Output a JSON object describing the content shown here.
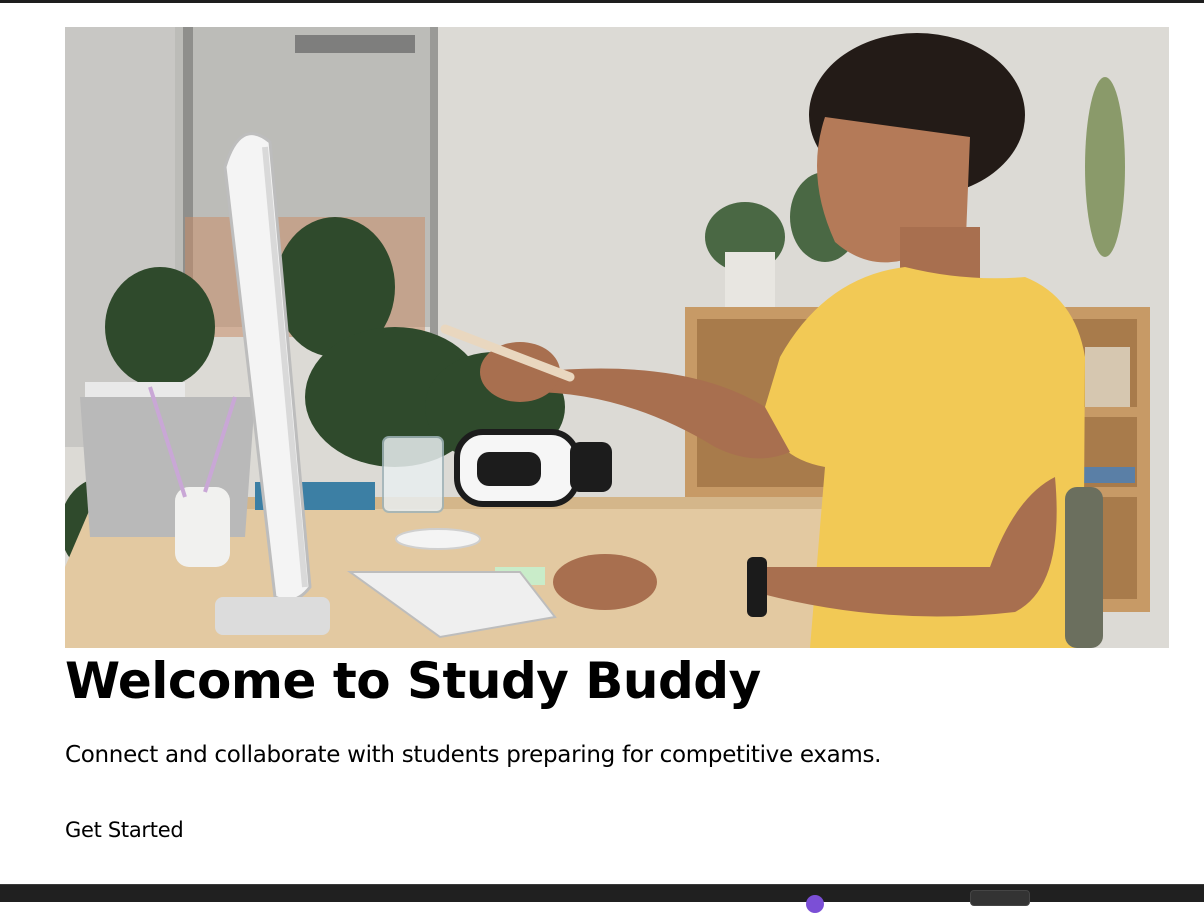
{
  "hero": {
    "image_alt": "Student in a yellow t-shirt studying at a desk with a computer, keyboard and VR headset"
  },
  "content": {
    "title": "Welcome to Study Buddy",
    "tagline": "Connect and collaborate with students preparing for competitive exams.",
    "cta_label": "Get Started"
  },
  "colors": {
    "shirt": "#f2c955",
    "wall": "#dcdad5",
    "desk": "#e3c9a1",
    "shelf": "#bf915c",
    "taskbar": "#202020"
  }
}
